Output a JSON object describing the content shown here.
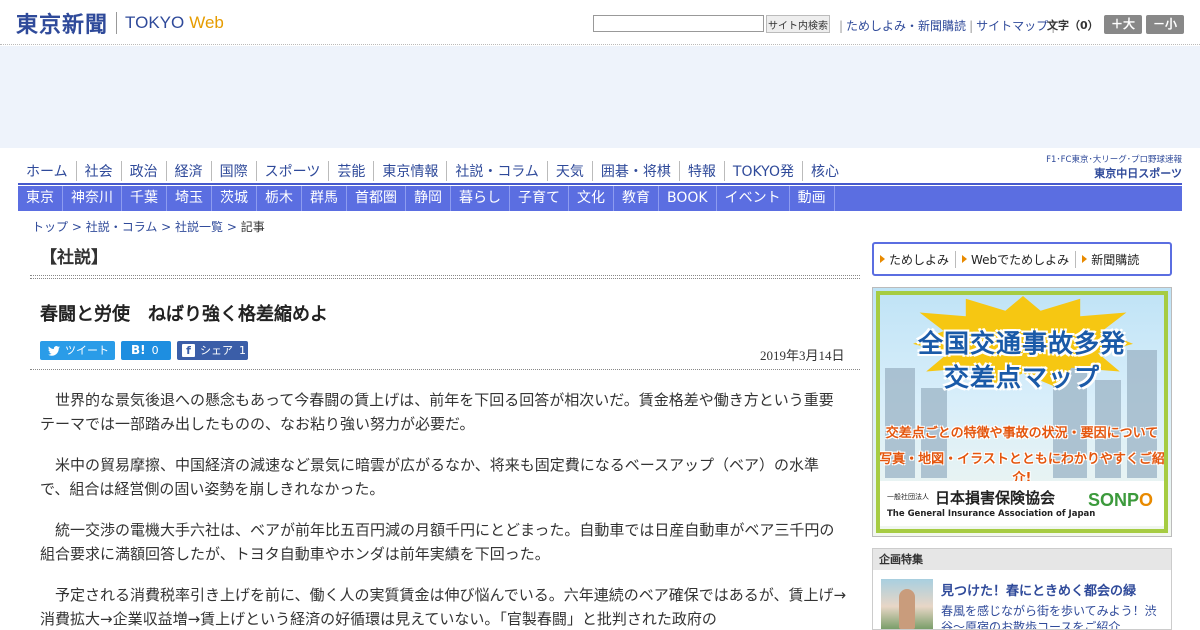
{
  "header": {
    "logo_jp": "東京新聞",
    "logo_en": "TOKYO",
    "logo_web": "Web",
    "search_placeholder": "",
    "search_button": "サイト内検索",
    "links": [
      "ためしよみ・新聞購読",
      "サイトマップ"
    ],
    "font_size_label": "文字（0）",
    "font_plus": "＋大",
    "font_minus": "－小"
  },
  "nav_main": [
    "ホーム",
    "社会",
    "政治",
    "経済",
    "国際",
    "スポーツ",
    "芸能",
    "東京情報",
    "社説・コラム",
    "天気",
    "囲碁・将棋",
    "特報",
    "TOKYO発",
    "核心"
  ],
  "chunichi": {
    "line1": "F1･FC東京･大リーグ･プロ野球速報",
    "line2": "東京中日スポーツ"
  },
  "nav_sub": [
    "東京",
    "神奈川",
    "千葉",
    "埼玉",
    "茨城",
    "栃木",
    "群馬",
    "首都圏",
    "静岡",
    "暮らし",
    "子育て",
    "文化",
    "教育",
    "BOOK",
    "イベント",
    "動画"
  ],
  "breadcrumb": {
    "items": [
      "トップ",
      "社説・コラム",
      "社説一覧"
    ],
    "separator": " > ",
    "current": "記事"
  },
  "article": {
    "section": "【社説】",
    "title": "春闘と労使　ねばり強く格差縮めよ",
    "share": {
      "tweet": "ツイート",
      "hatena_count": "0",
      "facebook_label": "シェア",
      "facebook_count": "1"
    },
    "date": "2019年3月14日",
    "paragraphs": [
      "世界的な景気後退への懸念もあって今春闘の賃上げは、前年を下回る回答が相次いだ。賃金格差や働き方という重要テーマでは一部踏み出したものの、なお粘り強い努力が必要だ。",
      "米中の貿易摩擦、中国経済の減速など景気に暗雲が広がるなか、将来も固定費になるベースアップ（ベア）の水準で、組合は経営側の固い姿勢を崩しきれなかった。",
      "統一交渉の電機大手六社は、ベアが前年比五百円減の月額千円にとどまった。自動車では日産自動車がベア三千円の組合要求に満額回答したが、トヨタ自動車やホンダは前年実績を下回った。",
      "予定される消費税率引き上げを前に、働く人の実質賃金は伸び悩んでいる。六年連続のベア確保ではあるが、賃上げ→消費拡大→企業収益増→賃上げという経済の好循環は見えていない。「官製春闘」と批判された政府の"
    ]
  },
  "sidebar": {
    "buttons": [
      "ためしよみ",
      "Webでためしよみ",
      "新聞購読"
    ],
    "banner": {
      "title_line1": "全国交通事故多発",
      "title_line2": "交差点マップ",
      "sub_line1": "交差点ごとの特徴や事故の状況・要因について",
      "sub_line2": "写真・地図・イラストとともにわかりやすくご紹介!",
      "org_small": "一般社団法人",
      "org": "日本損害保険協会",
      "org_en": "The General Insurance Association of Japan",
      "logo_a": "SONP",
      "logo_b": "O"
    },
    "feature": {
      "heading": "企画特集",
      "title": "見つけた！春にときめく都会の緑",
      "desc": "春風を感じながら街を歩いてみよう！渋谷～原宿のお散歩コースをご紹介"
    }
  }
}
